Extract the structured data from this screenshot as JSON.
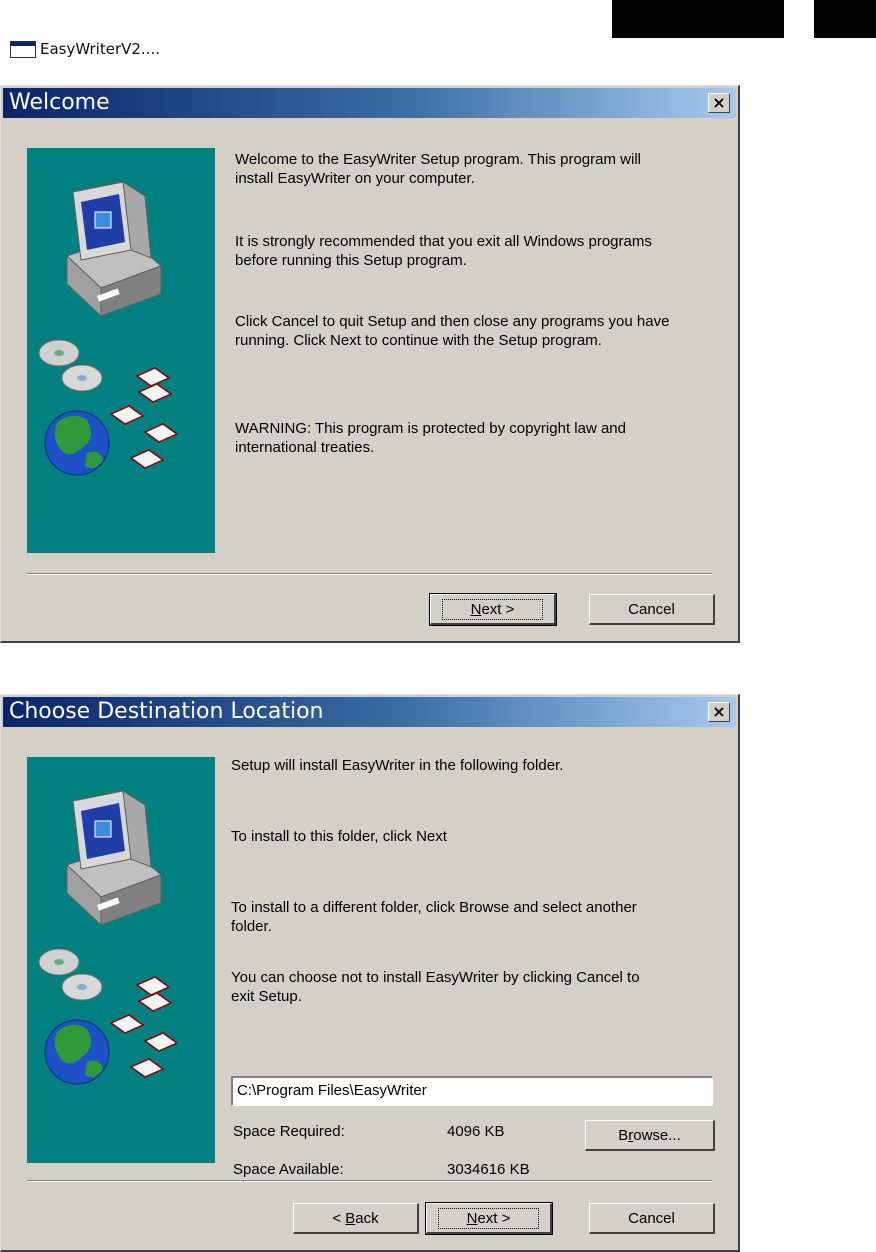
{
  "taskbar": {
    "app_label": "EasyWriterV2...."
  },
  "colors": {
    "dialog_bg": "#d4d0c8",
    "title_gradient_start": "#0a246a",
    "title_gradient_end": "#a6caf0",
    "art_panel": "#008080"
  },
  "icons": [
    "app-window-icon",
    "close-icon",
    "computer-icon",
    "cd-icon",
    "floppy-disk-icon",
    "globe-icon"
  ],
  "welcome": {
    "title": "Welcome",
    "close_glyph": "×",
    "paragraphs": [
      [
        "Welcome to the EasyWriter Setup program. This program will",
        "install EasyWriter on your computer."
      ],
      [
        "It is strongly recommended that you exit all Windows programs",
        "before running this Setup program."
      ],
      [
        "Click Cancel to quit Setup and then close any programs you have",
        "running. Click Next to continue with the Setup program."
      ],
      [
        "WARNING: This program is protected by copyright law and",
        "international treaties."
      ]
    ],
    "next_button": {
      "mnemonic": "N",
      "rest": "ext >"
    },
    "cancel_button": "Cancel"
  },
  "destination": {
    "title": "Choose Destination Location",
    "close_glyph": "×",
    "paragraphs": [
      [
        "Setup will install EasyWriter in the following folder."
      ],
      [
        "To install to this folder, click Next"
      ],
      [
        "To install to a different folder, click Browse and select another",
        "folder."
      ],
      [
        "You can choose not to install EasyWriter by clicking Cancel to",
        "exit Setup."
      ]
    ],
    "folder_path": "C:\\Program Files\\EasyWriter",
    "space_required_label": "Space Required:",
    "space_required_value": "4096 KB",
    "space_available_label": "Space Available:",
    "space_available_value": "3034616 KB",
    "browse_button": {
      "before": "B",
      "mnemonic": "r",
      "rest": "owse..."
    },
    "back_button": {
      "prefix": "< ",
      "mnemonic": "B",
      "rest": "ack"
    },
    "next_button": {
      "mnemonic": "N",
      "rest": "ext >"
    },
    "cancel_button": "Cancel"
  }
}
